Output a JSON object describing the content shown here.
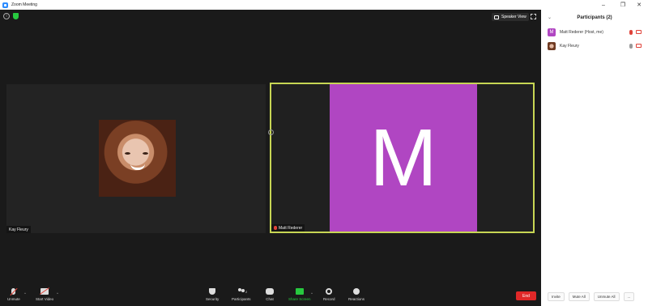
{
  "window": {
    "title": "Zoom Meeting",
    "controls": [
      "–",
      "❐",
      "✕"
    ]
  },
  "top": {
    "speaker_view_label": "Speaker View"
  },
  "tiles": [
    {
      "name": "Kay Fleury"
    },
    {
      "name": "Matt Rederer",
      "avatar_letter": "M"
    }
  ],
  "toolbar": {
    "unmute": "Unmute",
    "start_video": "Start Video",
    "security": "Security",
    "participants": "Participants",
    "participants_count": "2",
    "chat": "Chat",
    "share_screen": "Share Screen",
    "record": "Record",
    "reactions": "Reactions",
    "end": "End"
  },
  "panel": {
    "title": "Participants (2)",
    "participants": [
      {
        "name": "Matt Rederer (Host, me)",
        "avatar_letter": "M"
      },
      {
        "name": "Kay Fleury"
      }
    ],
    "buttons": {
      "invite": "Invite",
      "mute_all": "Mute All",
      "unmute_all": "Unmute All",
      "more": "..."
    }
  },
  "colors": {
    "avatar": "#b046c2",
    "active_speaker_border": "#c7d654",
    "end_button": "#e02828",
    "share_green": "#27c93f"
  }
}
